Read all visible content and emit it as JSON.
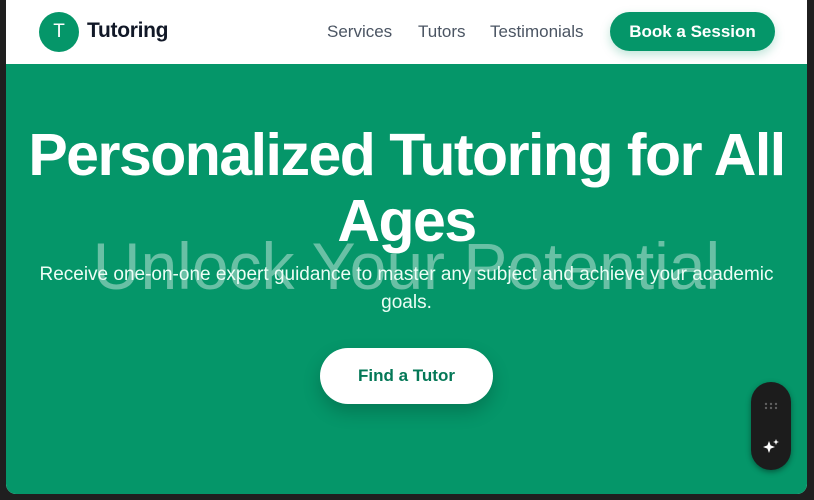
{
  "navbar": {
    "logo_letter": "T",
    "brand": "Tutoring",
    "links": [
      "Services",
      "Tutors",
      "Testimonials"
    ],
    "cta": "Book a Session"
  },
  "hero": {
    "title": "Personalized Tutoring for All Ages",
    "watermark": "Unlock Your Potential",
    "subtitle": "Receive one-on-one expert guidance to master any subject and achieve your academic goals.",
    "cta": "Find a Tutor"
  },
  "widget": {
    "icons": [
      "drag-handle-icon",
      "sparkle-icon"
    ]
  },
  "colors": {
    "brand_green": "#059669",
    "dark_text": "#111827",
    "nav_text": "#4b5563",
    "button_text": "#047857",
    "widget_bg": "#1c1c1c"
  }
}
